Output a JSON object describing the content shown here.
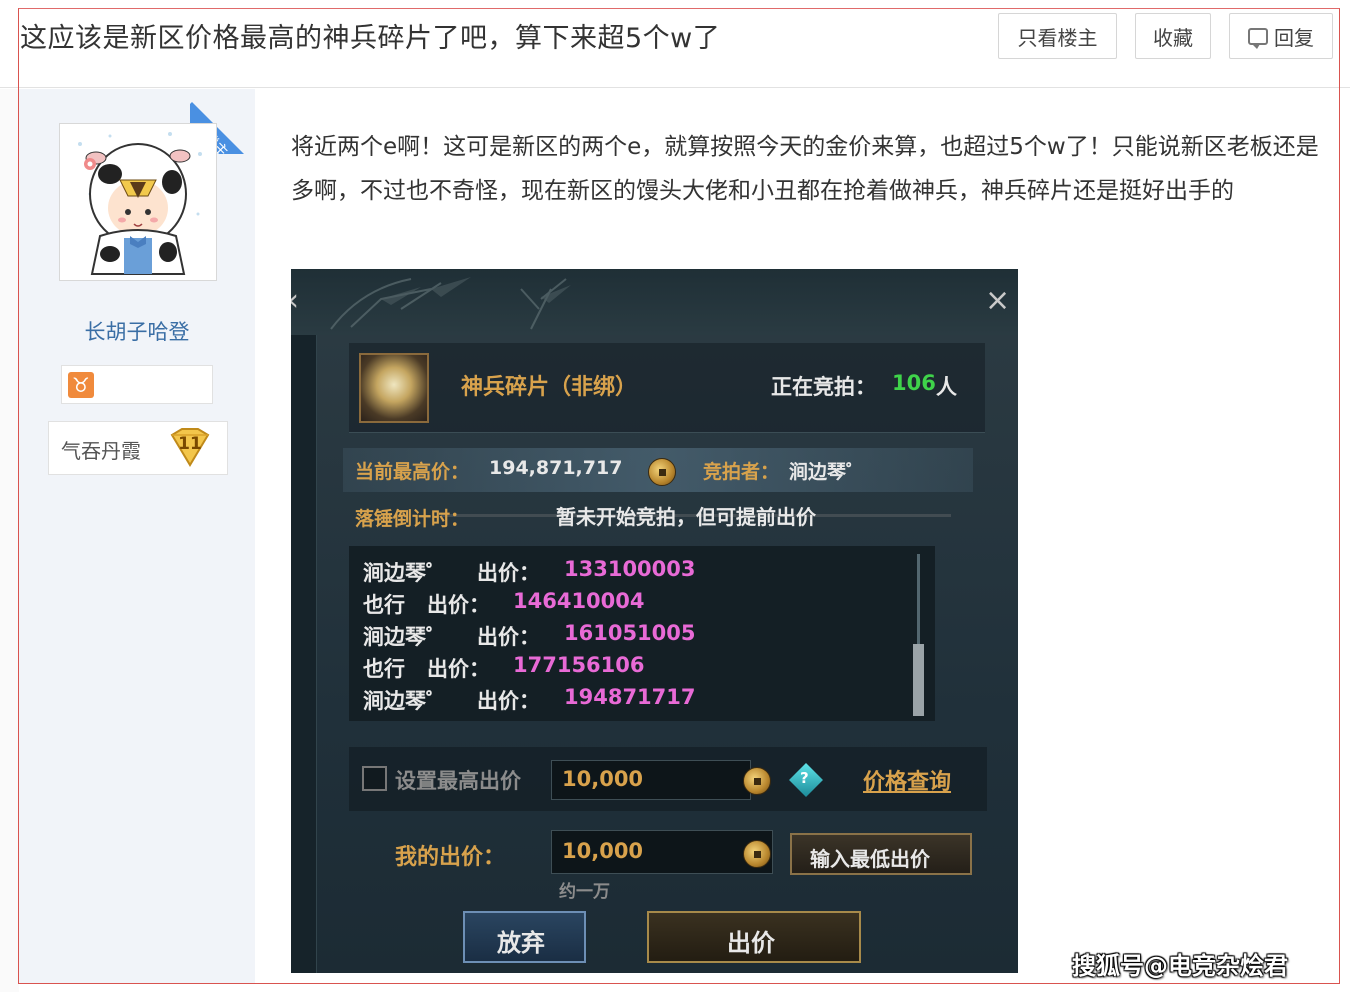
{
  "header": {
    "title": "这应该是新区价格最高的神兵碎片了吧，算下来超5个w了",
    "only_owner_label": "只看楼主",
    "favorite_label": "收藏",
    "reply_label": "回复"
  },
  "author": {
    "badge": "楼主",
    "username": "长胡子哈登",
    "zodiac_symbol": "♉",
    "rank_name": "气吞丹霞",
    "rank_level": "11"
  },
  "post": {
    "text": "将近两个e啊！这可是新区的两个e，就算按照今天的金价来算，也超过5个w了！只能说新区老板还是多啊，不过也不奇怪，现在新区的馒头大佬和小丑都在抢着做神兵，神兵碎片还是挺好出手的"
  },
  "game": {
    "close_glyph": "×",
    "item_name": "神兵碎片（非绑）",
    "bidding_label": "正在竞拍：",
    "bidding_count": "106",
    "bidding_unit": "人",
    "highest_label": "当前最高价：",
    "highest_value": "194,871,717",
    "bidder_label": "竞拍者：",
    "bidder_name": "涧边琴゜",
    "countdown_label": "落锤倒计时：",
    "countdown_status": "暂未开始竞拍，但可提前出价",
    "bid_label": "出价：",
    "bids": [
      {
        "name": "涧边琴゜",
        "amount": "133100003"
      },
      {
        "name": "也行",
        "amount": "146410004"
      },
      {
        "name": "涧边琴゜",
        "amount": "161051005"
      },
      {
        "name": "也行",
        "amount": "177156106"
      },
      {
        "name": "涧边琴゜",
        "amount": "194871717"
      }
    ],
    "set_max_label": "设置最高出价",
    "set_max_value": "10,000",
    "price_query_label": "价格查询",
    "my_bid_label": "我的出价：",
    "my_bid_value": "10,000",
    "my_bid_hint": "约一万",
    "min_bid_button": "输入最低出价",
    "give_up_button": "放弃",
    "bid_button": "出价"
  },
  "watermark": "搜狐号@电竞杂烩君",
  "colors": {
    "frame_border": "#d9534f",
    "username": "#3a6ea5",
    "ribbon": "#4a90e2",
    "game_gold": "#d8a24c",
    "game_green": "#3fd34a",
    "game_pink": "#e86ad6"
  }
}
